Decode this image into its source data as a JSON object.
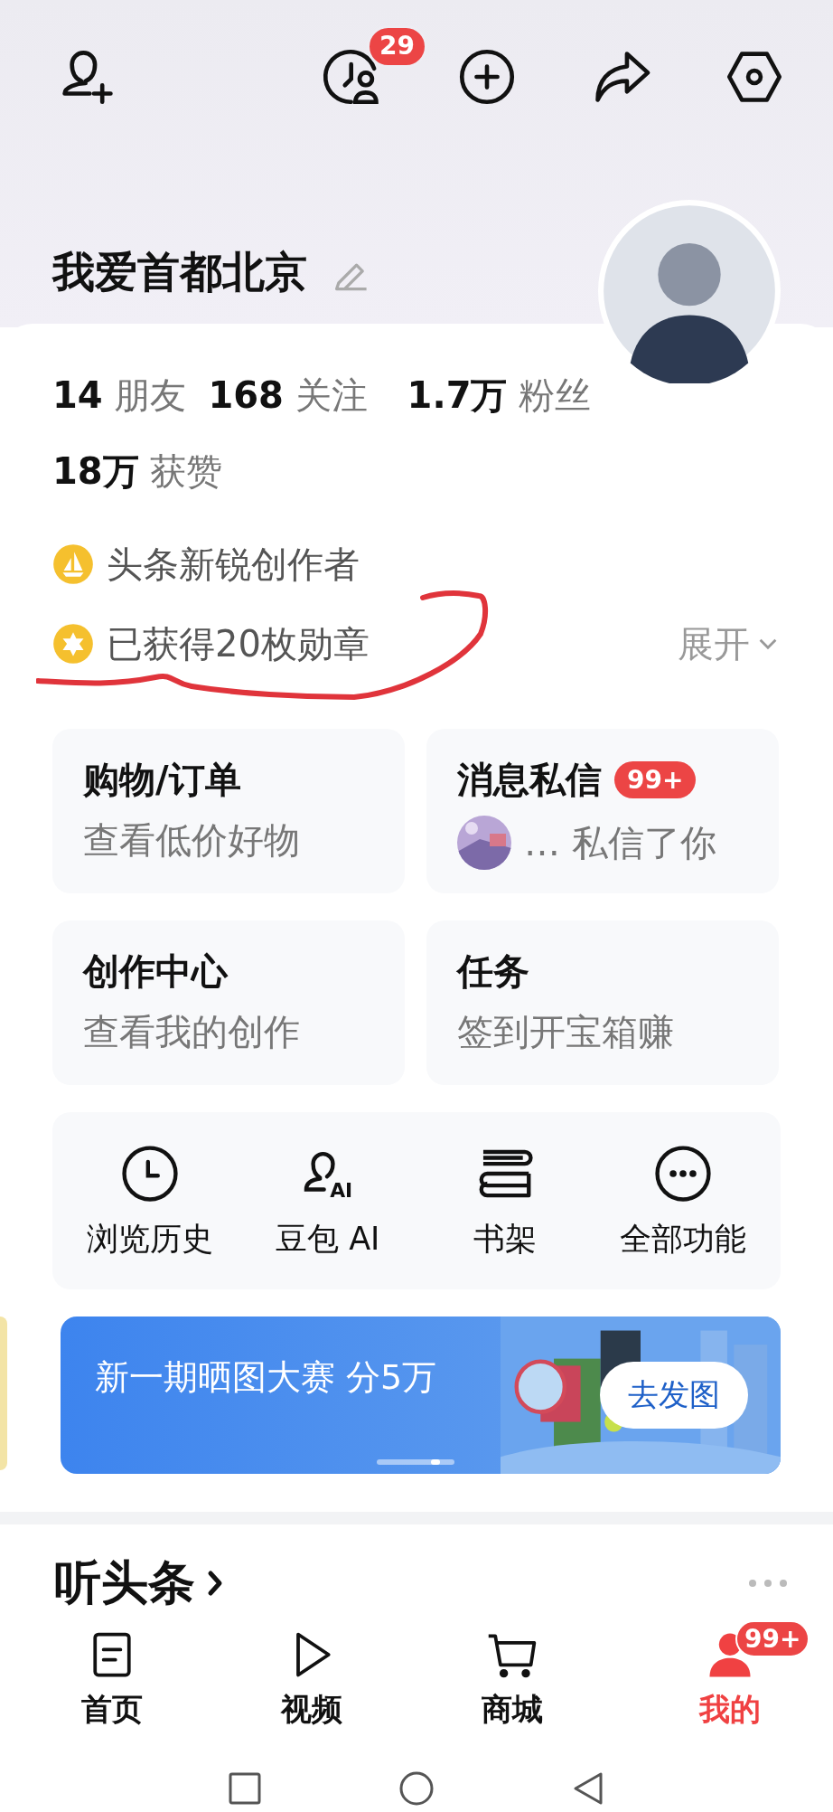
{
  "header": {
    "actions": [
      {
        "kind": "add-friend"
      },
      {
        "kind": "history",
        "badge": "29"
      },
      {
        "kind": "add"
      },
      {
        "kind": "share"
      },
      {
        "kind": "settings"
      }
    ]
  },
  "profile": {
    "name": "我爱首都北京",
    "stats": [
      "**14** 朋友",
      "**168** 关注",
      "**1.7万** 粉丝",
      "**18万** 获赞"
    ],
    "badges": [
      {
        "kind": "sailboat",
        "text": "头条新锐创作者"
      },
      {
        "kind": "medal",
        "text": "已获得20枚勋章"
      }
    ],
    "expand": "展开"
  },
  "cards": [
    {
      "kind": "plain",
      "title": "购物/订单",
      "subtitle": "查看低价好物"
    },
    {
      "kind": "message",
      "title": "消息私信",
      "badge": "99+",
      "subtitle": "… 私信了你"
    },
    {
      "kind": "plain",
      "title": "创作中心",
      "subtitle": "查看我的创作"
    },
    {
      "kind": "plain",
      "title": "任务",
      "subtitle": "签到开宝箱赚"
    }
  ],
  "tools": [
    {
      "kind": "clock",
      "label": "浏览历史"
    },
    {
      "kind": "ai",
      "label": "豆包 AI",
      "icon_text": "AI"
    },
    {
      "kind": "books",
      "label": "书架"
    },
    {
      "kind": "more",
      "label": "全部功能"
    }
  ],
  "banner": {
    "title": "新一期晒图大赛 分5万",
    "button": "去发图"
  },
  "listen": {
    "title": "听头条"
  },
  "nav": [
    {
      "kind": "home",
      "label": "首页",
      "selected": false
    },
    {
      "kind": "video",
      "label": "视频",
      "selected": false
    },
    {
      "kind": "cart",
      "label": "商城",
      "selected": false
    },
    {
      "kind": "person",
      "label": "我的",
      "selected": true,
      "badge": "99+"
    }
  ]
}
